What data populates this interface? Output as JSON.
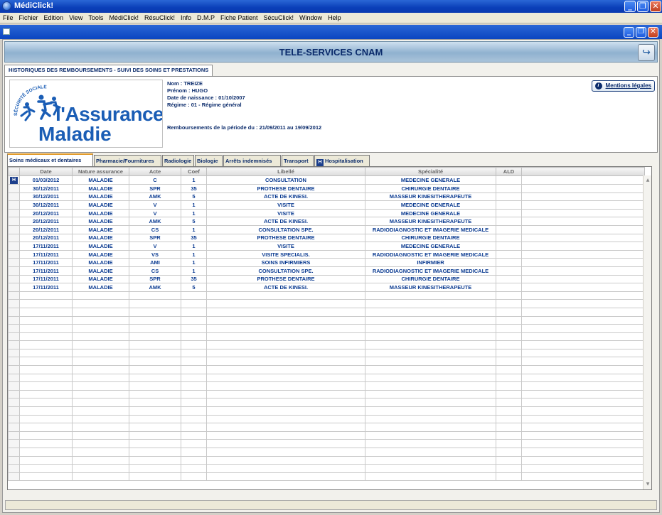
{
  "window": {
    "title": "MédiClick!"
  },
  "menu": [
    "File",
    "Fichier",
    "Edition",
    "View",
    "Tools",
    "MédiClick!",
    "RésuClick!",
    "Info",
    "D.M.P",
    "Fiche Patient",
    "SécuClick!",
    "Window",
    "Help"
  ],
  "banner": {
    "title": "TELE-SERVICES CNAM"
  },
  "main_tab": "HISTORIQUES DES REMBOURSEMENTS - SUIVI DES SOINS ET PRESTATIONS",
  "logo": {
    "arc_text": "SÉCURITÉ SOCIALE",
    "line1": "l'Assurance",
    "line2": "Maladie"
  },
  "patient": {
    "nom": "Nom : TREIZE",
    "prenom": "Prénom : HUGO",
    "naissance": "Date de naissance : 01/10/2007",
    "regime": "Régime : 01 -  Régime général",
    "periode": "Remboursements de la période du : 21/09/2011 au 19/09/2012"
  },
  "legal_button": "Mentions légales",
  "subtabs": [
    "Soins médicaux et dentaires",
    "Pharmacie/Fournitures",
    "Radiologie",
    "Biologie",
    "Arrêts indemnisés",
    "Transport",
    "Hospitalisation"
  ],
  "table": {
    "columns": [
      "Date",
      "Nature assurance",
      "Acte",
      "Coef",
      "Libellé",
      "Spécialité",
      "ALD"
    ],
    "rows": [
      [
        "01/03/2012",
        "MALADIE",
        "C",
        "1",
        "CONSULTATION",
        "MEDECINE GENERALE",
        ""
      ],
      [
        "30/12/2011",
        "MALADIE",
        "SPR",
        "35",
        "PROTHESE DENTAIRE",
        "CHIRURGIE DENTAIRE",
        ""
      ],
      [
        "30/12/2011",
        "MALADIE",
        "AMK",
        "5",
        "ACTE DE KINESI.",
        "MASSEUR KINESITHERAPEUTE",
        ""
      ],
      [
        "30/12/2011",
        "MALADIE",
        "V",
        "1",
        "VISITE",
        "MEDECINE GENERALE",
        ""
      ],
      [
        "20/12/2011",
        "MALADIE",
        "V",
        "1",
        "VISITE",
        "MEDECINE GENERALE",
        ""
      ],
      [
        "20/12/2011",
        "MALADIE",
        "AMK",
        "5",
        "ACTE DE KINESI.",
        "MASSEUR KINESITHERAPEUTE",
        ""
      ],
      [
        "20/12/2011",
        "MALADIE",
        "CS",
        "1",
        "CONSULTATION SPE.",
        "RADIODIAGNOSTIC ET IMAGERIE MEDICALE",
        ""
      ],
      [
        "20/12/2011",
        "MALADIE",
        "SPR",
        "35",
        "PROTHESE DENTAIRE",
        "CHIRURGIE DENTAIRE",
        ""
      ],
      [
        "17/11/2011",
        "MALADIE",
        "V",
        "1",
        "VISITE",
        "MEDECINE GENERALE",
        ""
      ],
      [
        "17/11/2011",
        "MALADIE",
        "VS",
        "1",
        "VISITE SPECIALIS.",
        "RADIODIAGNOSTIC ET IMAGERIE MEDICALE",
        ""
      ],
      [
        "17/11/2011",
        "MALADIE",
        "AMI",
        "1",
        "SOINS INFIRMIERS",
        "INFIRMIER",
        ""
      ],
      [
        "17/11/2011",
        "MALADIE",
        "CS",
        "1",
        "CONSULTATION SPE.",
        "RADIODIAGNOSTIC ET IMAGERIE MEDICALE",
        ""
      ],
      [
        "17/11/2011",
        "MALADIE",
        "SPR",
        "35",
        "PROTHESE DENTAIRE",
        "CHIRURGIE DENTAIRE",
        ""
      ],
      [
        "17/11/2011",
        "MALADIE",
        "AMK",
        "5",
        "ACTE DE KINESI.",
        "MASSEUR KINESITHERAPEUTE",
        ""
      ]
    ]
  }
}
